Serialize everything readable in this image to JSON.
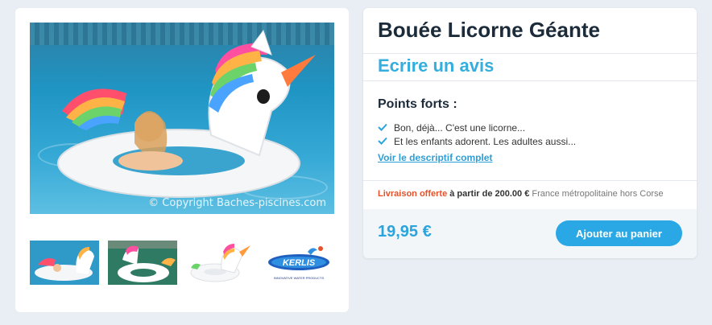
{
  "product": {
    "title": "Bouée Licorne Géante",
    "review_link": "Ecrire un avis",
    "strengths_heading": "Points forts :",
    "strengths": [
      "Bon, déjà... C'est une licorne...",
      "Et les enfants adorent. Les adultes aussi..."
    ],
    "description_link": "Voir le descriptif complet",
    "delivery": {
      "offer": "Livraison offerte",
      "threshold": "à partir de 200.00 €",
      "zone": "France métropolitaine hors Corse"
    },
    "price": "19,95 €",
    "cart_button": "Ajouter au panier"
  },
  "gallery": {
    "copyright": "© Copyright Baches-piscines.com",
    "thumbnails": [
      "thumb-pool-side",
      "thumb-pool-top",
      "thumb-white-bg",
      "kerlis-logo"
    ],
    "brand_tagline": "INNOVATIVE WATER PRODUCTS"
  },
  "colors": {
    "accent": "#2aa8e6",
    "review_link": "#35aede",
    "offer": "#e4522b",
    "title": "#1c2b3a",
    "page_bg": "#e8eef3"
  },
  "icons": {
    "strength_bullet": "check-icon"
  }
}
